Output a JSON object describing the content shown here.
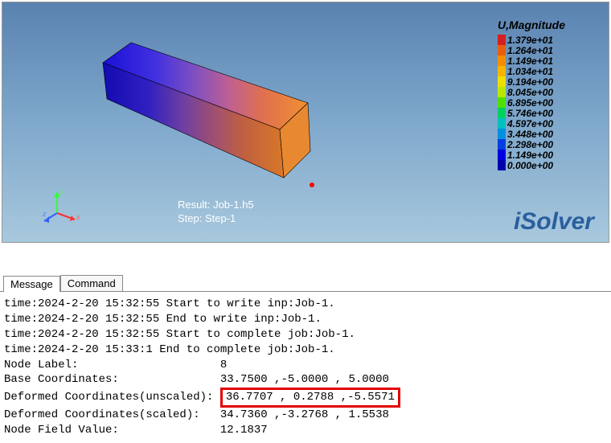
{
  "viewport": {
    "result_line1": "Result: Job-1.h5",
    "result_line2": "Step: Step-1",
    "logo": "iSolver",
    "triad": {
      "x": "x",
      "y": "y",
      "z": "z"
    }
  },
  "legend": {
    "title": "U,Magnitude",
    "entries": [
      {
        "color": "#d42020",
        "label": "1.379e+01"
      },
      {
        "color": "#e66010",
        "label": "1.264e+01"
      },
      {
        "color": "#f28e00",
        "label": "1.149e+01"
      },
      {
        "color": "#f7b400",
        "label": "1.034e+01"
      },
      {
        "color": "#f0de00",
        "label": "9.194e+00"
      },
      {
        "color": "#b8e800",
        "label": "8.045e+00"
      },
      {
        "color": "#50e000",
        "label": "6.895e+00"
      },
      {
        "color": "#00d060",
        "label": "5.746e+00"
      },
      {
        "color": "#00c0c0",
        "label": "4.597e+00"
      },
      {
        "color": "#0090e0",
        "label": "3.448e+00"
      },
      {
        "color": "#0040e0",
        "label": "2.298e+00"
      },
      {
        "color": "#0000e0",
        "label": "1.149e+00"
      },
      {
        "color": "#0000b0",
        "label": "0.000e+00"
      }
    ]
  },
  "tabs": {
    "message": "Message",
    "command": "Command"
  },
  "messages": {
    "l1": "time:2024-2-20 15:32:55 Start to write inp:Job-1.",
    "l2": "time:2024-2-20 15:32:55 End to write inp:Job-1.",
    "l3": "time:2024-2-20 15:32:55 Start to complete job:Job-1.",
    "l4": "time:2024-2-20 15:33:1 End to complete job:Job-1.",
    "l5a": "Node Label:                     ",
    "l5b": "8",
    "l6a": "Base Coordinates:               ",
    "l6b": "33.7500 ,-5.0000 , 5.0000",
    "l7a": "Deformed Coordinates(unscaled): ",
    "l7b": "36.7707 , 0.2788 ,-5.5571",
    "l8a": "Deformed Coordinates(scaled):   ",
    "l8b": "34.7360 ,-3.2768 , 1.5538",
    "l9a": "Node Field Value:               ",
    "l9b": "12.1837"
  }
}
